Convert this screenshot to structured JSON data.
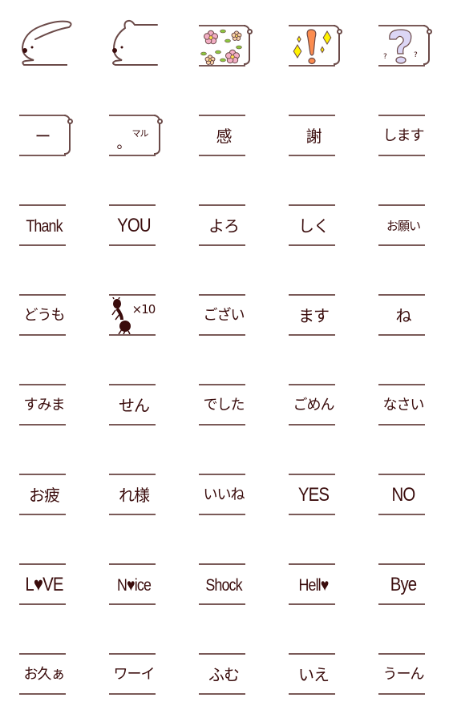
{
  "sticker_set": {
    "colors": {
      "ink": "#3a0c0c",
      "outline": "#6b4a48",
      "rule_line": "#7a5a58",
      "flower_pink": "#f2aec4",
      "leaf_green": "#8cc63f",
      "exclaim_orange": "#fb8c4f",
      "sparkle_yellow": "#fff200",
      "question_lavender": "#dcd6f5"
    },
    "rows": [
      {
        "cells": [
          {
            "kind": "rabbit",
            "icon": "rabbit-icon",
            "text": ""
          },
          {
            "kind": "bear",
            "icon": "bear-icon",
            "text": ""
          },
          {
            "kind": "flowers",
            "icon": "flowers-icon",
            "text": ""
          },
          {
            "kind": "exclaim",
            "icon": "exclamation-sparkle-icon",
            "text": ""
          },
          {
            "kind": "question",
            "icon": "question-mark-icon",
            "text": ""
          }
        ]
      },
      {
        "cells": [
          {
            "kind": "bear-text",
            "icon": "dash-icon",
            "text": "ー"
          },
          {
            "kind": "bear-text",
            "icon": "maru-icon",
            "text": "マル",
            "extra": "。"
          },
          {
            "kind": "text",
            "text": "感"
          },
          {
            "kind": "text",
            "text": "謝"
          },
          {
            "kind": "text",
            "text": "します"
          }
        ]
      },
      {
        "cells": [
          {
            "kind": "text",
            "latin": true,
            "text": "Thank"
          },
          {
            "kind": "text",
            "latin": true,
            "text": "YOU"
          },
          {
            "kind": "text",
            "text": "よろ"
          },
          {
            "kind": "text",
            "text": "しく"
          },
          {
            "kind": "text",
            "small": true,
            "text": "お願い"
          }
        ]
      },
      {
        "cells": [
          {
            "kind": "text",
            "text": "どうも"
          },
          {
            "kind": "ant",
            "icon": "ant-icon",
            "text": "×10"
          },
          {
            "kind": "text",
            "text": "ござい"
          },
          {
            "kind": "text",
            "text": "ます"
          },
          {
            "kind": "text",
            "text": "ね"
          }
        ]
      },
      {
        "cells": [
          {
            "kind": "text",
            "text": "すみま"
          },
          {
            "kind": "text",
            "text": "せん"
          },
          {
            "kind": "text",
            "text": "でした"
          },
          {
            "kind": "text",
            "text": "ごめん"
          },
          {
            "kind": "text",
            "text": "なさい"
          }
        ]
      },
      {
        "cells": [
          {
            "kind": "text",
            "text": "お疲"
          },
          {
            "kind": "text",
            "text": "れ様"
          },
          {
            "kind": "text",
            "text": "いいね"
          },
          {
            "kind": "text",
            "latin": true,
            "text": "YES"
          },
          {
            "kind": "text",
            "latin": true,
            "text": "NO"
          }
        ]
      },
      {
        "cells": [
          {
            "kind": "text",
            "latin": true,
            "text": "L♥VE"
          },
          {
            "kind": "text",
            "latin": true,
            "text": "N♥ice"
          },
          {
            "kind": "text",
            "latin": true,
            "text": "Shock"
          },
          {
            "kind": "text",
            "latin": true,
            "text": "Hell♥"
          },
          {
            "kind": "text",
            "latin": true,
            "text": "Bye"
          }
        ]
      },
      {
        "cells": [
          {
            "kind": "text",
            "text": "お久ぁ"
          },
          {
            "kind": "text",
            "text": "ワーイ"
          },
          {
            "kind": "text",
            "text": "ふむ"
          },
          {
            "kind": "text",
            "text": "いえ"
          },
          {
            "kind": "text",
            "text": "うーん"
          }
        ]
      }
    ]
  }
}
